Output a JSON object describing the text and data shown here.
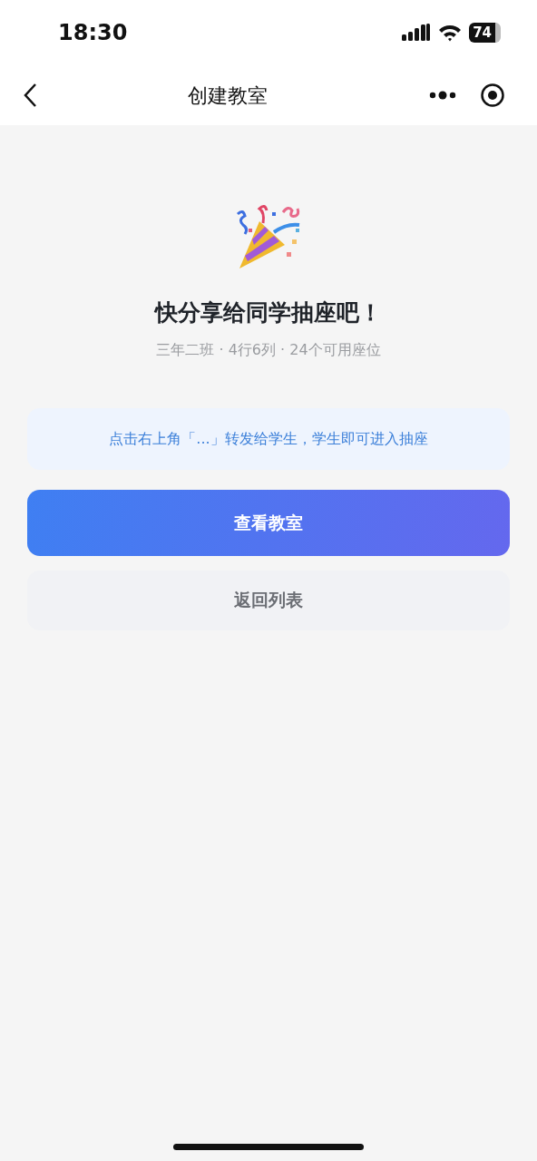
{
  "status_bar": {
    "time": "18:30",
    "battery": "74"
  },
  "nav": {
    "title": "创建教室"
  },
  "hero": {
    "title": "快分享给同学抽座吧！",
    "subtitle": "三年二班 · 4行6列 · 24个可用座位"
  },
  "tip": "点击右上角「...」转发给学生，学生即可进入抽座",
  "buttons": [
    {
      "label": "查看教室",
      "kind": "primary"
    },
    {
      "label": "返回列表",
      "kind": "secondary"
    }
  ]
}
